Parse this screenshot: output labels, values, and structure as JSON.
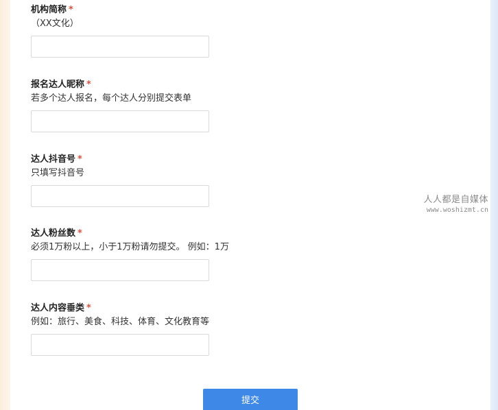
{
  "form": {
    "fields": [
      {
        "label": "机构简称",
        "required_mark": "*",
        "hint": "（XX文化）",
        "value": ""
      },
      {
        "label": "报名达人昵称",
        "required_mark": "*",
        "hint": "若多个达人报名，每个达人分别提交表单",
        "value": ""
      },
      {
        "label": "达人抖音号",
        "required_mark": "*",
        "hint": "只填写抖音号",
        "value": ""
      },
      {
        "label": "达人粉丝数",
        "required_mark": "*",
        "hint": "必须1万粉以上，小于1万粉请勿提交。 例如：1万",
        "value": ""
      },
      {
        "label": "达人内容垂类",
        "required_mark": "*",
        "hint": "例如：旅行、美食、科技、体育、文化教育等",
        "value": ""
      }
    ],
    "submit_label": "提交"
  },
  "watermark": {
    "line1": "人人都是自媒体",
    "line2": "www.woshizmt.cn"
  },
  "colors": {
    "required": "#e0513e",
    "submit_bg": "#3e88e8",
    "input_border": "#d9d9d9"
  }
}
